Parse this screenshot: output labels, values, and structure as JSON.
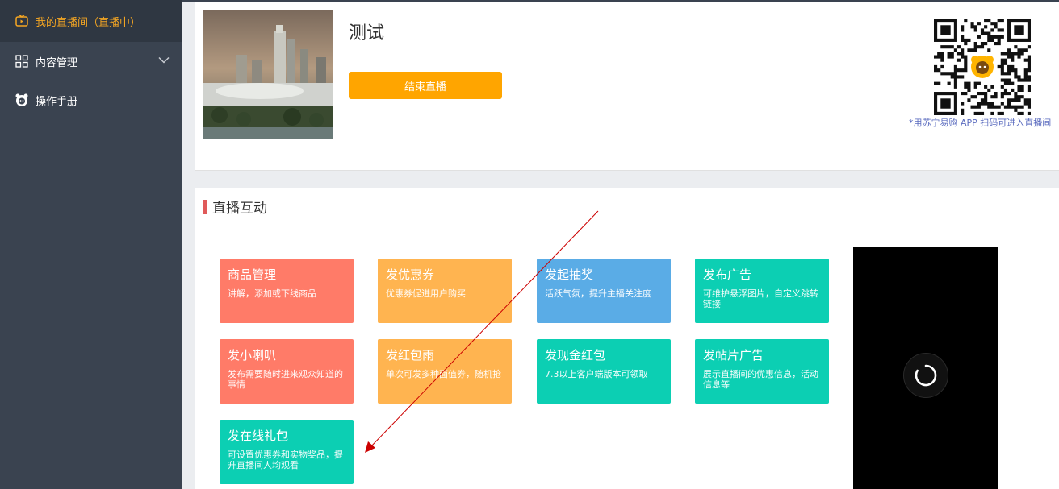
{
  "sidebar": {
    "items": [
      {
        "label": "我的直播间（直播中）",
        "icon": "tv-icon",
        "active": true
      },
      {
        "label": "内容管理",
        "icon": "grid-icon",
        "expandable": true
      },
      {
        "label": "操作手册",
        "icon": "mascot-icon"
      }
    ]
  },
  "room": {
    "title": "测试",
    "end_button": "结束直播",
    "qr_caption": "*用苏宁易购 APP 扫码可进入直播间"
  },
  "interaction": {
    "section_title": "直播互动",
    "tiles": [
      {
        "title": "商品管理",
        "desc": "讲解，添加或下线商品",
        "color": "#ff7b68"
      },
      {
        "title": "发优惠券",
        "desc": "优惠券促进用户购买",
        "color": "#ffb450"
      },
      {
        "title": "发起抽奖",
        "desc": "活跃气氛，提升主播关注度",
        "color": "#5aace6"
      },
      {
        "title": "发布广告",
        "desc": "可维护悬浮图片，自定义跳转链接",
        "color": "#0ccfb3"
      },
      {
        "title": "发小喇叭",
        "desc": "发布需要随时进来观众知道的事情",
        "color": "#ff7b68"
      },
      {
        "title": "发红包雨",
        "desc": "单次可发多种面值券，随机抢",
        "color": "#ffb450"
      },
      {
        "title": "发现金红包",
        "desc": "7.3以上客户端版本可领取",
        "color": "#0ccfb3"
      },
      {
        "title": "发帖片广告",
        "desc": "展示直播间的优惠信息，活动信息等",
        "color": "#0ccfb3"
      },
      {
        "title": "发在线礼包",
        "desc": "可设置优惠券和实物奖品，提升直播间人均观看",
        "color": "#0ccfb3"
      }
    ]
  },
  "colors": {
    "sidebar_bg": "#3a4350",
    "accent": "#ffa500",
    "annotation_arrow": "#cc0000"
  }
}
